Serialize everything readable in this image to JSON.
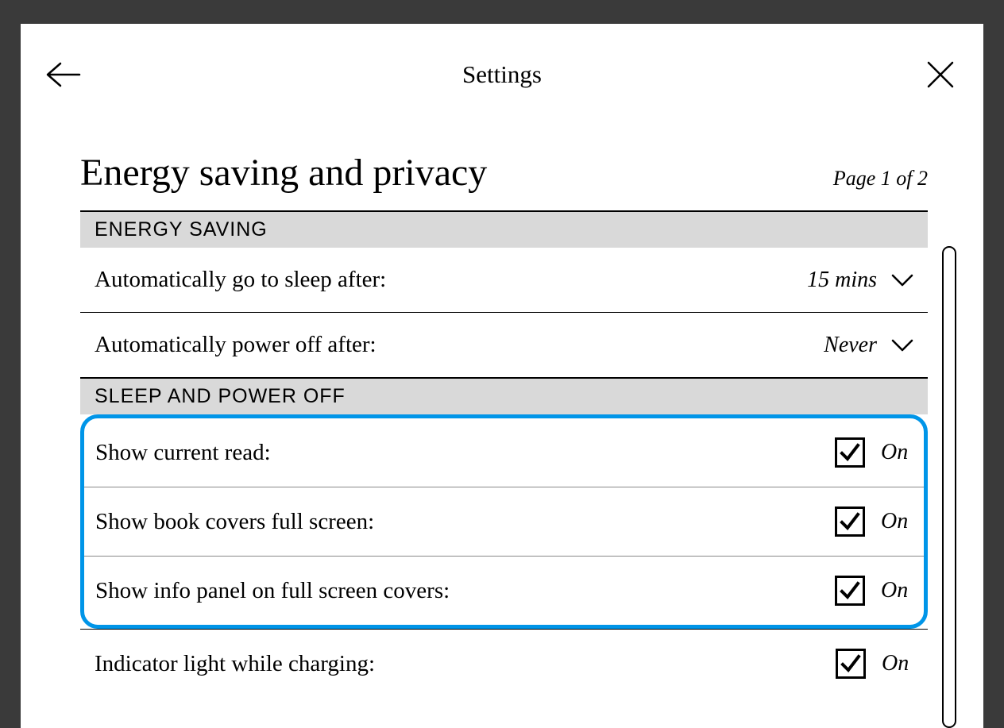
{
  "header": {
    "title": "Settings"
  },
  "page": {
    "heading": "Energy saving and privacy",
    "indicator": "Page 1 of 2"
  },
  "sections": {
    "energy_saving": {
      "title": "ENERGY SAVING",
      "sleep_after": {
        "label": "Automatically go to sleep after:",
        "value": "15 mins"
      },
      "power_off_after": {
        "label": "Automatically power off after:",
        "value": "Never"
      }
    },
    "sleep_power_off": {
      "title": "SLEEP AND POWER OFF",
      "show_current_read": {
        "label": "Show current read:",
        "state": "On"
      },
      "show_covers_full": {
        "label": "Show book covers full screen:",
        "state": "On"
      },
      "show_info_panel": {
        "label": "Show info panel on full screen covers:",
        "state": "On"
      },
      "indicator_light": {
        "label": "Indicator light while charging:",
        "state": "On"
      }
    }
  }
}
